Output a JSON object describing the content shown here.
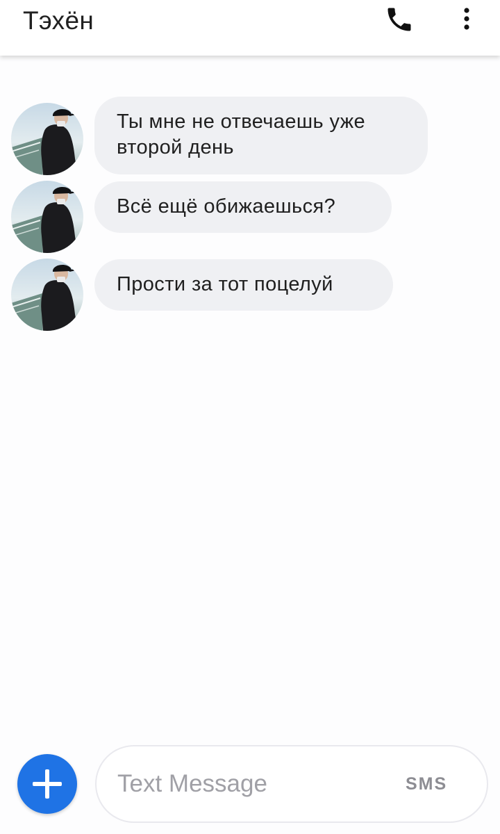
{
  "header": {
    "title": "Тэхён",
    "phone_icon": "phone-icon",
    "more_icon": "more-vert-icon"
  },
  "messages": [
    {
      "text": "Ты мне не отвечаешь уже\nвторой день"
    },
    {
      "text": "Всё ещё обижаешься?"
    },
    {
      "text": "Прости за тот поцелуй"
    }
  ],
  "compose": {
    "add_icon": "plus-icon",
    "placeholder": "Text Message",
    "value": "",
    "send_mode_label": "SMS"
  },
  "colors": {
    "accent": "#1f73e5",
    "bubble": "#eff0f3",
    "background": "#fdfdfe"
  }
}
